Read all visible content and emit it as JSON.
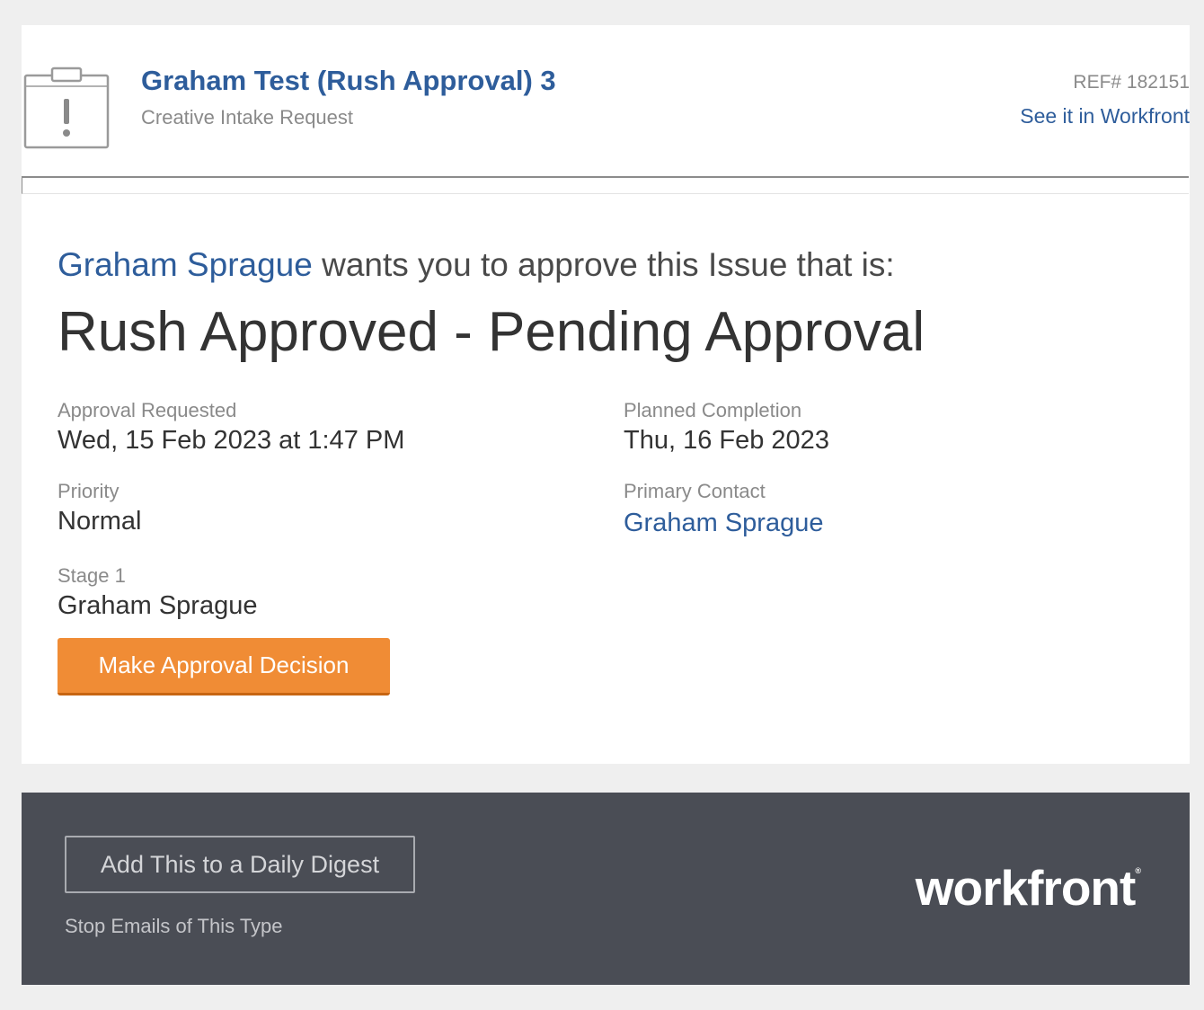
{
  "header": {
    "title": "Graham Test (Rush Approval) 3",
    "subtitle": "Creative Intake Request",
    "ref": "REF# 182151",
    "view_link": "See it in Workfront",
    "icon": "clipboard-alert-icon"
  },
  "body": {
    "requester": "Graham Sprague",
    "request_text": " wants you to approve this Issue that is:",
    "status": "Rush Approved - Pending Approval",
    "fields": {
      "approval_requested": {
        "label": "Approval Requested",
        "value": "Wed, 15 Feb 2023 at 1:47 PM"
      },
      "planned_completion": {
        "label": "Planned Completion",
        "value": "Thu, 16 Feb 2023"
      },
      "priority": {
        "label": "Priority",
        "value": "Normal"
      },
      "primary_contact": {
        "label": "Primary Contact",
        "value": "Graham Sprague"
      },
      "stage": {
        "label": "Stage 1",
        "value": "Graham Sprague"
      }
    },
    "action_button": "Make Approval Decision"
  },
  "footer": {
    "digest_button": "Add This to a Daily Digest",
    "stop_link": "Stop Emails of This Type",
    "brand": "workfront",
    "brand_mark": "®"
  },
  "colors": {
    "link": "#2e5d9b",
    "action": "#f08c35",
    "footer_bg": "#4a4d55",
    "page_bg": "#efefef"
  }
}
